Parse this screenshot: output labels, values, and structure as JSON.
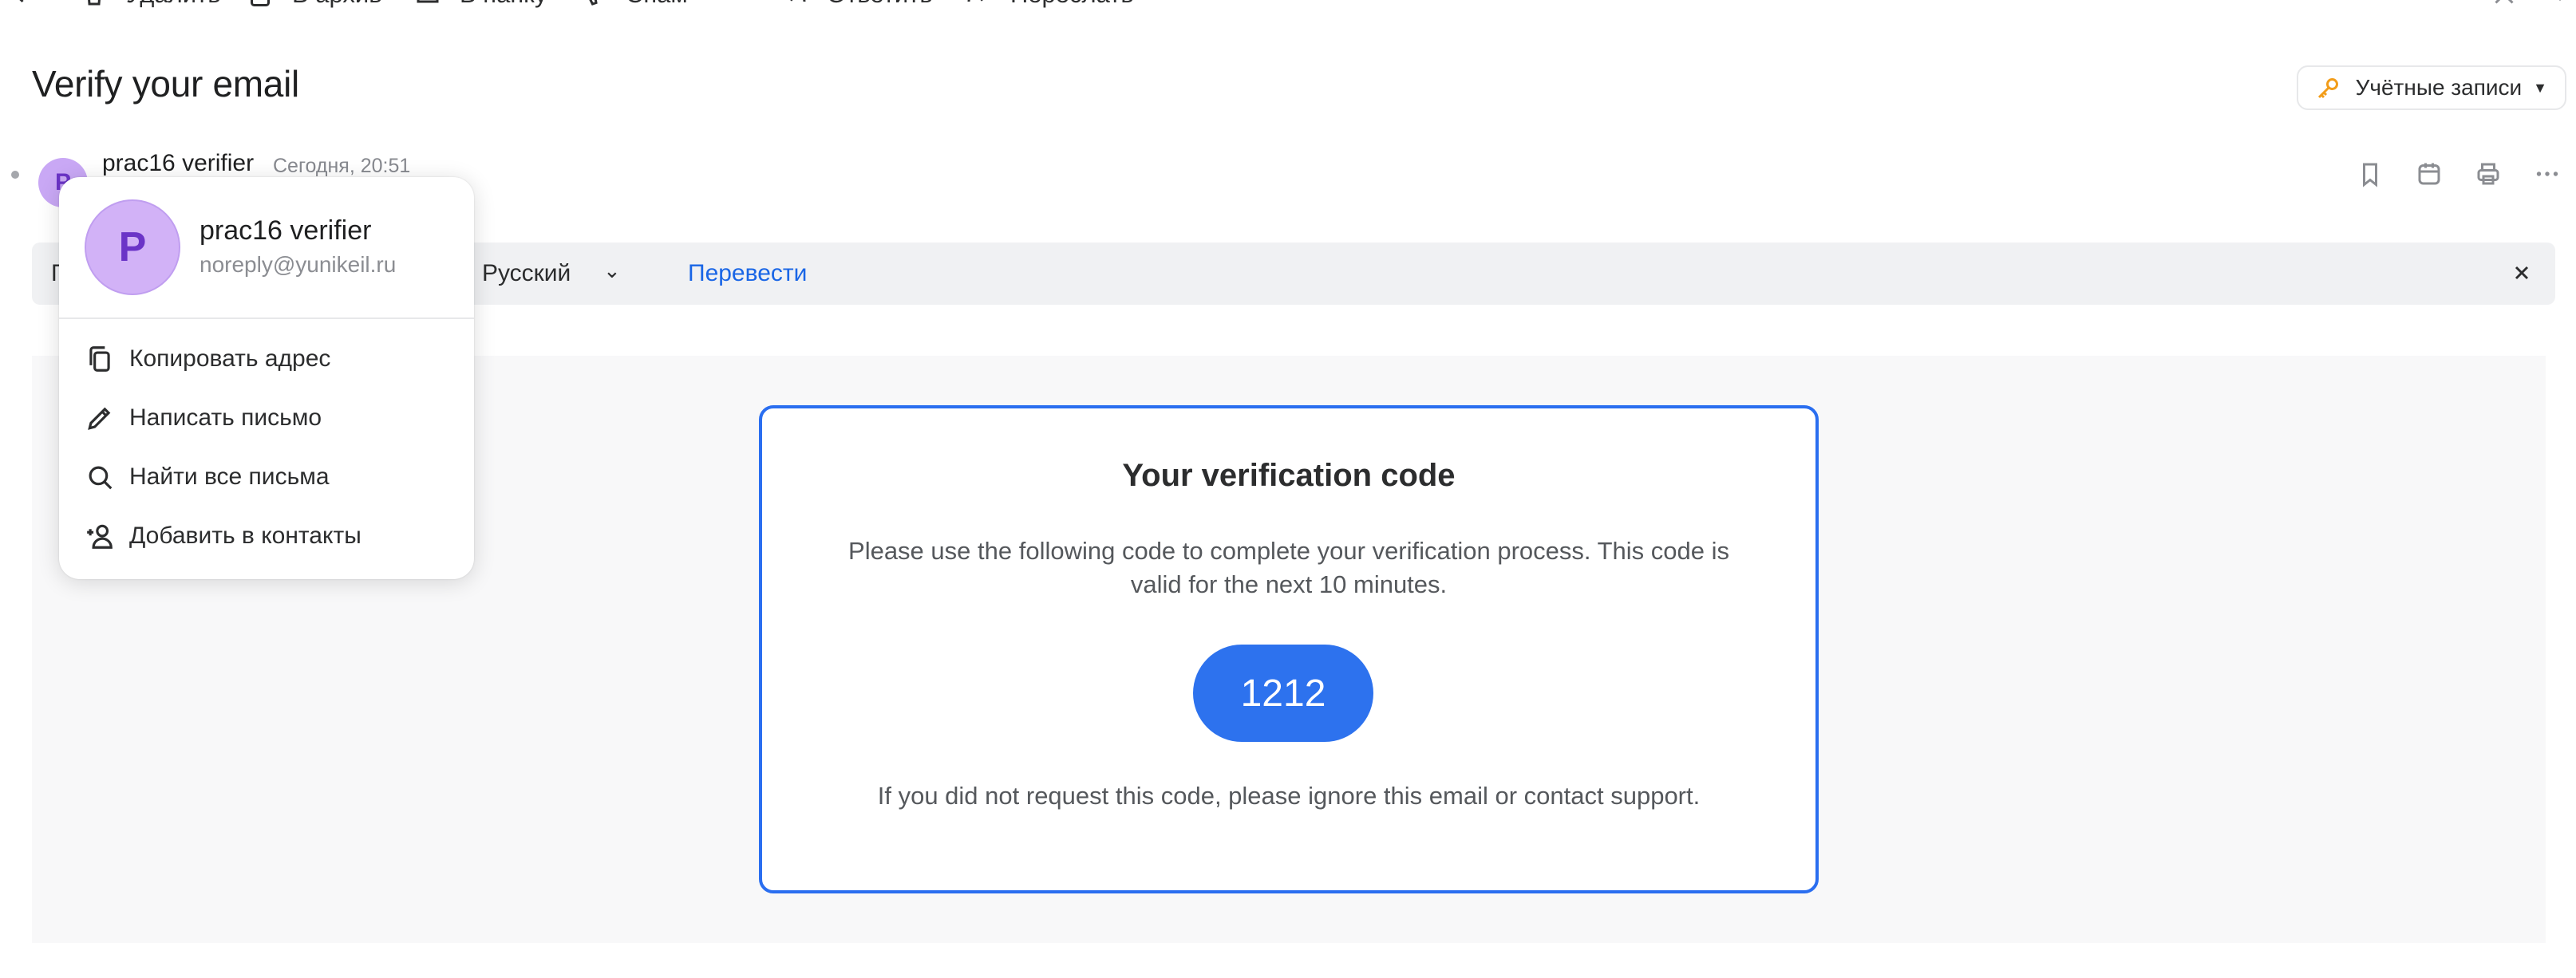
{
  "toolbar": {
    "delete_label": "Удалить",
    "archive_label": "В архив",
    "folder_label": "В папку",
    "spam_label": "Спам",
    "reply_label": "Ответить",
    "forward_label": "Переслать"
  },
  "message": {
    "subject": "Verify your email",
    "sender_initial": "P",
    "sender_name": "prac16 verifier",
    "date": "Сегодня, 20:51"
  },
  "accounts": {
    "label": "Учётные записи"
  },
  "translate_bar": {
    "prefix": "П",
    "target_language": "Русский",
    "action_label": "Перевести"
  },
  "email_body": {
    "title": "Your verification code",
    "text": "Please use the following code to complete your verification process. This code is valid for the next 10 minutes.",
    "code": "1212",
    "footer": "If you did not request this code, please ignore this email or contact support."
  },
  "sender_popup": {
    "initial": "P",
    "name": "prac16 verifier",
    "email": "noreply@yunikeil.ru",
    "menu": [
      {
        "label": "Копировать адрес",
        "icon": "copy-icon"
      },
      {
        "label": "Написать письмо",
        "icon": "pencil-icon"
      },
      {
        "label": "Найти все письма",
        "icon": "search-icon"
      },
      {
        "label": "Добавить в контакты",
        "icon": "add-contact-icon"
      }
    ]
  },
  "colors": {
    "accent": "#2d72ee",
    "link": "#1a66e6",
    "avatar_bg": "#d2b2f7",
    "avatar_fg": "#6b34c7"
  }
}
